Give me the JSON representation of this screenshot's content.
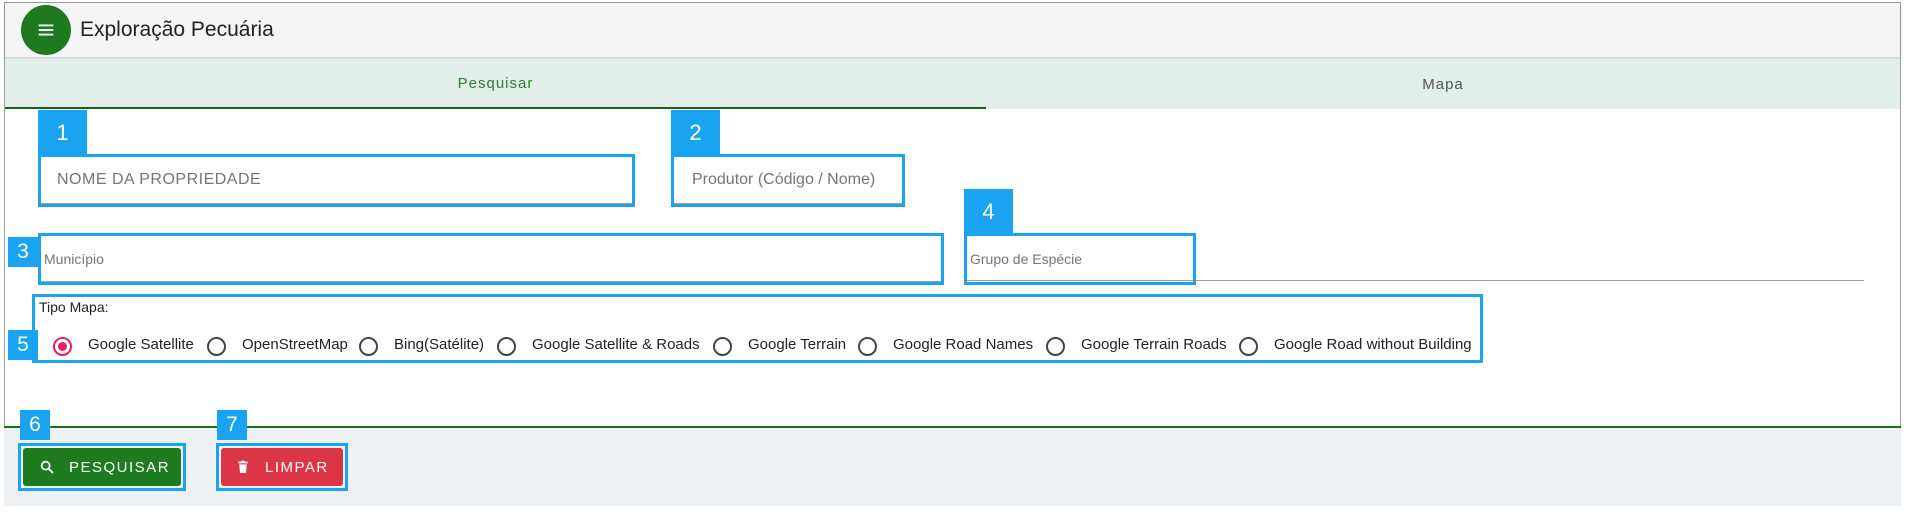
{
  "app": {
    "title": "Exploração Pecuária",
    "menu_icon": "menu-icon"
  },
  "colors": {
    "primary": "#1f7a1f",
    "tab_bg": "#e1eeea",
    "annotation": "#1aa3f0",
    "danger": "#dc3545",
    "radio_checked": "#e91e63"
  },
  "tabs": [
    {
      "label": "Pesquisar",
      "active": true
    },
    {
      "label": "Mapa",
      "active": false
    }
  ],
  "form": {
    "propriedade": {
      "placeholder": "NOME DA PROPRIEDADE",
      "value": ""
    },
    "produtor": {
      "placeholder": "Produtor (Código / Nome)",
      "value": ""
    },
    "municipio": {
      "placeholder": "Município",
      "value": ""
    },
    "grupo_especie": {
      "placeholder": "Grupo de Espécie",
      "value": ""
    }
  },
  "tipo_mapa": {
    "label": "Tipo Mapa:",
    "selected": "Google Satellite",
    "options": [
      "Google Satellite",
      "OpenStreetMap",
      "Bing(Satélite)",
      "Google Satellite & Roads",
      "Google Terrain",
      "Google Road Names",
      "Google Terrain Roads",
      "Google Road without Building"
    ]
  },
  "buttons": {
    "search": {
      "label": "PESQUISAR",
      "icon": "search-icon"
    },
    "clear": {
      "label": "LIMPAR",
      "icon": "trash-icon"
    }
  },
  "annotations": [
    "1",
    "2",
    "3",
    "4",
    "5",
    "6",
    "7"
  ]
}
